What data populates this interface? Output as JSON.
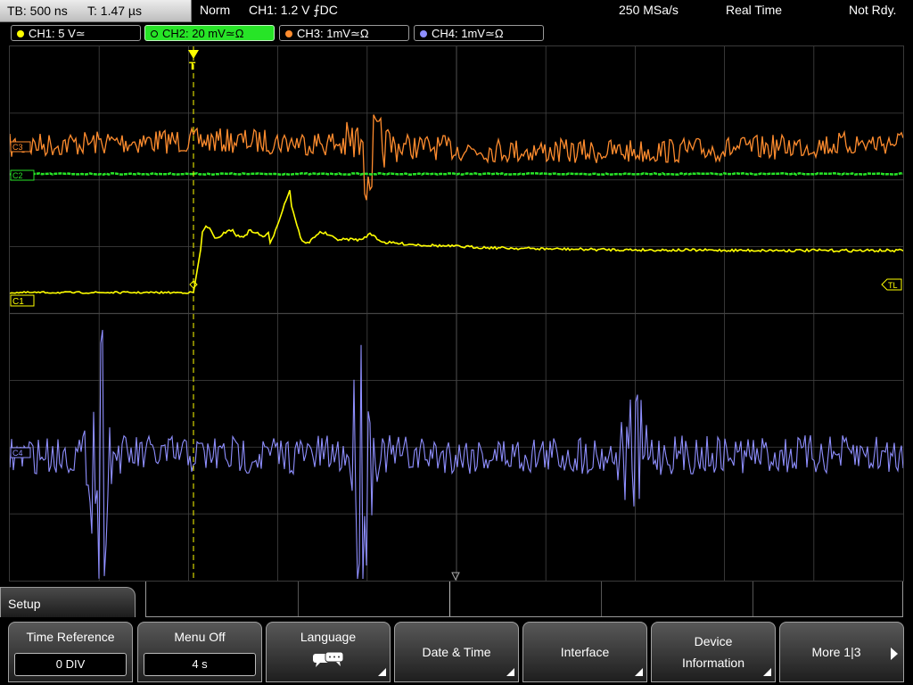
{
  "topbar": {
    "timebase": "TB: 500 ns",
    "time_offset": "T: 1.47 µs",
    "trigger_mode": "Norm",
    "trigger_info": "CH1: 1.2 V ⨍DC",
    "sample_rate": "250 MSa/s",
    "acq_mode": "Real Time",
    "status": "Not Rdy."
  },
  "channels": [
    {
      "label": "CH1: 5 V≃",
      "color": "#ffff00",
      "active": false
    },
    {
      "label": "CH2: 20 mV≃Ω",
      "color": "#27e427",
      "active": true
    },
    {
      "label": "CH3: 1mV≃Ω",
      "color": "#ff8c2e",
      "active": false
    },
    {
      "label": "CH4: 1mV≃Ω",
      "color": "#8f8fff",
      "active": false
    }
  ],
  "markers": {
    "ch3": "C3",
    "ch2": "C2",
    "ch1": "C1",
    "ch4": "C4",
    "trigger_level": "TL",
    "trigger_pos": "T"
  },
  "menu": {
    "title": "Setup",
    "softkeys": [
      {
        "label": "Time Reference",
        "value": "0 DIV"
      },
      {
        "label": "Menu Off",
        "value": "4 s"
      },
      {
        "label": "Language",
        "icon": "speech-bubbles-icon"
      },
      {
        "label": "Date & Time"
      },
      {
        "label": "Interface"
      },
      {
        "label": "Device Information",
        "line1": "Device",
        "line2": "Information"
      },
      {
        "label": "More 1|3"
      }
    ]
  },
  "colors": {
    "ch1": "#ffff00",
    "ch2": "#27e427",
    "ch3": "#ff8c2e",
    "ch4": "#8f8fff",
    "grid": "#444444"
  }
}
